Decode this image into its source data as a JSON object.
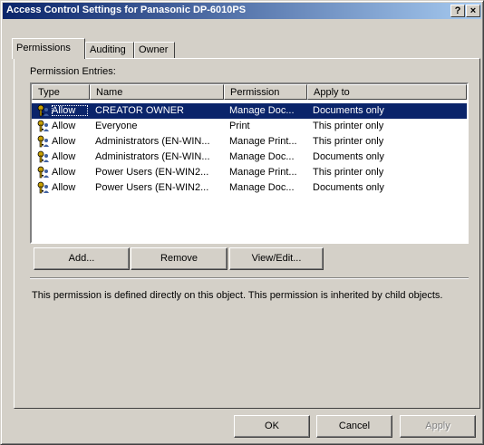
{
  "window": {
    "title": "Access Control Settings for Panasonic DP-6010PS",
    "help_glyph": "?",
    "close_glyph": "×"
  },
  "tabs": [
    {
      "label": "Permissions",
      "active": true
    },
    {
      "label": "Auditing",
      "active": false
    },
    {
      "label": "Owner",
      "active": false
    }
  ],
  "permission_entries_label": "Permission Entries:",
  "list": {
    "columns": [
      "Type",
      "Name",
      "Permission",
      "Apply to"
    ],
    "rows": [
      {
        "type": "Allow",
        "name": "CREATOR OWNER",
        "permission": "Manage Doc...",
        "apply_to": "Documents only",
        "selected": true
      },
      {
        "type": "Allow",
        "name": "Everyone",
        "permission": "Print",
        "apply_to": "This printer only",
        "selected": false
      },
      {
        "type": "Allow",
        "name": "Administrators (EN-WIN...",
        "permission": "Manage Print...",
        "apply_to": "This printer only",
        "selected": false
      },
      {
        "type": "Allow",
        "name": "Administrators (EN-WIN...",
        "permission": "Manage Doc...",
        "apply_to": "Documents only",
        "selected": false
      },
      {
        "type": "Allow",
        "name": "Power Users (EN-WIN2...",
        "permission": "Manage Print...",
        "apply_to": "This printer only",
        "selected": false
      },
      {
        "type": "Allow",
        "name": "Power Users (EN-WIN2...",
        "permission": "Manage Doc...",
        "apply_to": "Documents only",
        "selected": false
      }
    ],
    "icon": "key-user-icon"
  },
  "buttons": {
    "add": "Add...",
    "remove": "Remove",
    "view_edit": "View/Edit...",
    "ok": "OK",
    "cancel": "Cancel",
    "apply": "Apply"
  },
  "info_text": "This permission is defined directly on this object. This permission is inherited by child objects.",
  "colors": {
    "title_start": "#0a246a",
    "title_end": "#a6caf0",
    "selection": "#0a246a",
    "face": "#d4d0c8"
  }
}
